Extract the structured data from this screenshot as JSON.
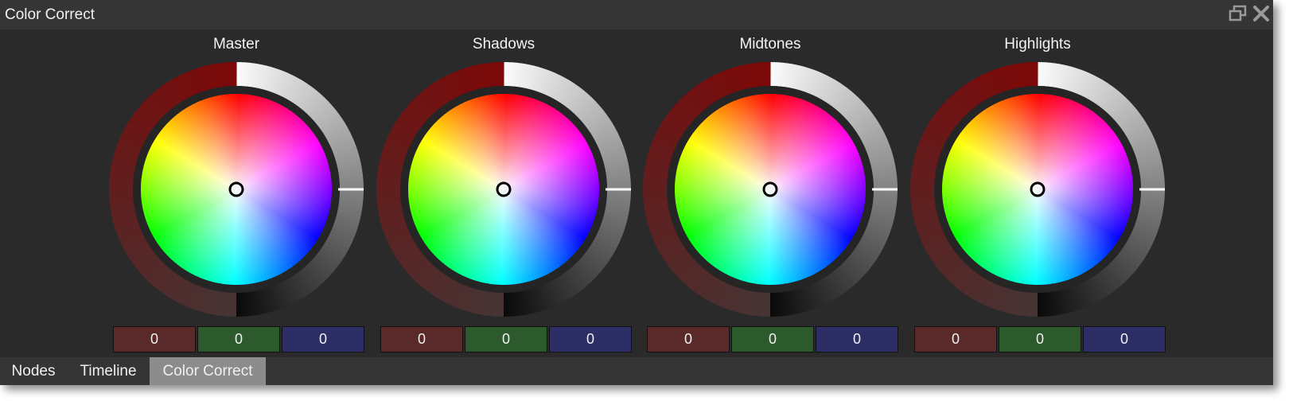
{
  "window": {
    "title": "Color Correct"
  },
  "wheels": [
    {
      "label": "Master",
      "values": [
        "0",
        "0",
        "0"
      ]
    },
    {
      "label": "Shadows",
      "values": [
        "0",
        "0",
        "0"
      ]
    },
    {
      "label": "Midtones",
      "values": [
        "0",
        "0",
        "0"
      ]
    },
    {
      "label": "Highlights",
      "values": [
        "0",
        "0",
        "0"
      ]
    }
  ],
  "channel_colors": {
    "red": "#5a2a2a",
    "green": "#2c5a2c",
    "blue": "#2e2e66"
  },
  "tabs": [
    {
      "label": "Nodes",
      "active": false
    },
    {
      "label": "Timeline",
      "active": false
    },
    {
      "label": "Color Correct",
      "active": true
    }
  ],
  "icons": {
    "restore": "restore-window-icon",
    "close": "close-icon"
  }
}
